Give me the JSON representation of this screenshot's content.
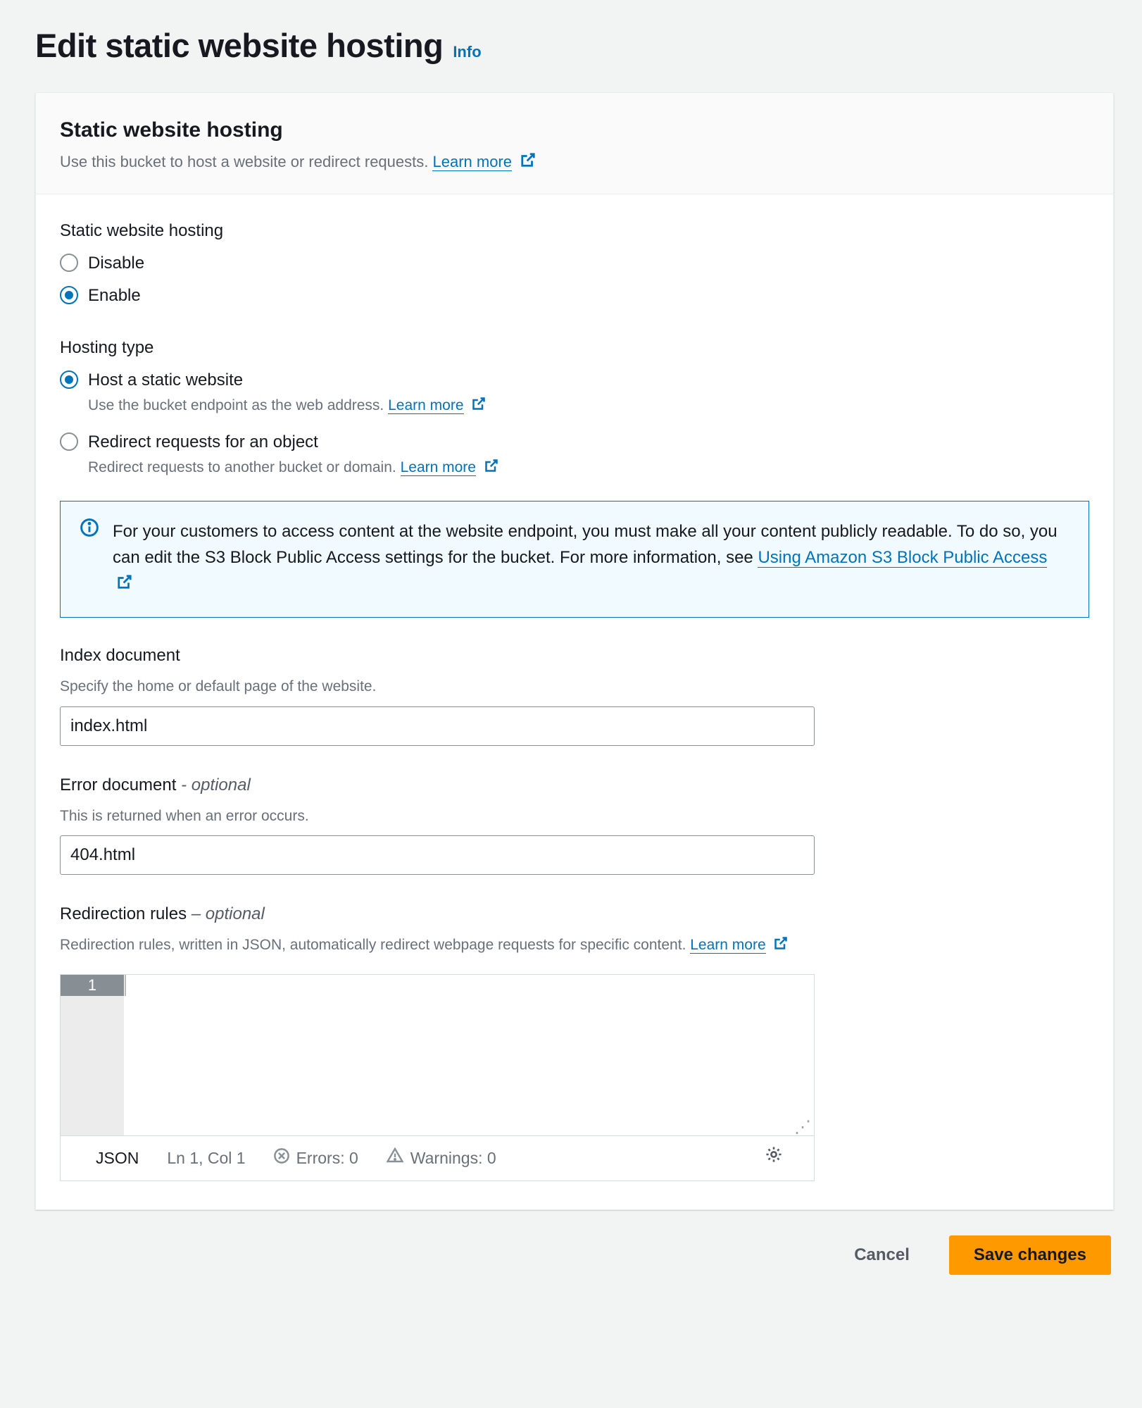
{
  "header": {
    "title": "Edit static website hosting",
    "info": "Info"
  },
  "panel": {
    "title": "Static website hosting",
    "subtitle": "Use this bucket to host a website or redirect requests.",
    "learn_more": "Learn more"
  },
  "hosting_toggle": {
    "label": "Static website hosting",
    "disable": "Disable",
    "enable": "Enable",
    "selected": "enable"
  },
  "hosting_type": {
    "label": "Hosting type",
    "options": [
      {
        "label": "Host a static website",
        "help": "Use the bucket endpoint as the web address.",
        "learn_more": "Learn more"
      },
      {
        "label": "Redirect requests for an object",
        "help": "Redirect requests to another bucket or domain.",
        "learn_more": "Learn more"
      }
    ],
    "selected_index": 0
  },
  "info_box": {
    "message": "For your customers to access content at the website endpoint, you must make all your content publicly readable. To do so, you can edit the S3 Block Public Access settings for the bucket. For more information, see ",
    "link": "Using Amazon S3 Block Public Access"
  },
  "index_document": {
    "label": "Index document",
    "help": "Specify the home or default page of the website.",
    "value": "index.html"
  },
  "error_document": {
    "label": "Error document",
    "optional_suffix": " - optional",
    "help": "This is returned when an error occurs.",
    "value": "404.html"
  },
  "redirection_rules": {
    "label": "Redirection rules",
    "optional_suffix": " – optional",
    "help": "Redirection rules, written in JSON, automatically redirect webpage requests for specific content.",
    "learn_more": "Learn more"
  },
  "editor": {
    "line_number": "1",
    "lang": "JSON",
    "cursor": "Ln 1, Col 1",
    "errors_label": "Errors: 0",
    "warnings_label": "Warnings: 0"
  },
  "footer": {
    "cancel": "Cancel",
    "save": "Save changes"
  }
}
